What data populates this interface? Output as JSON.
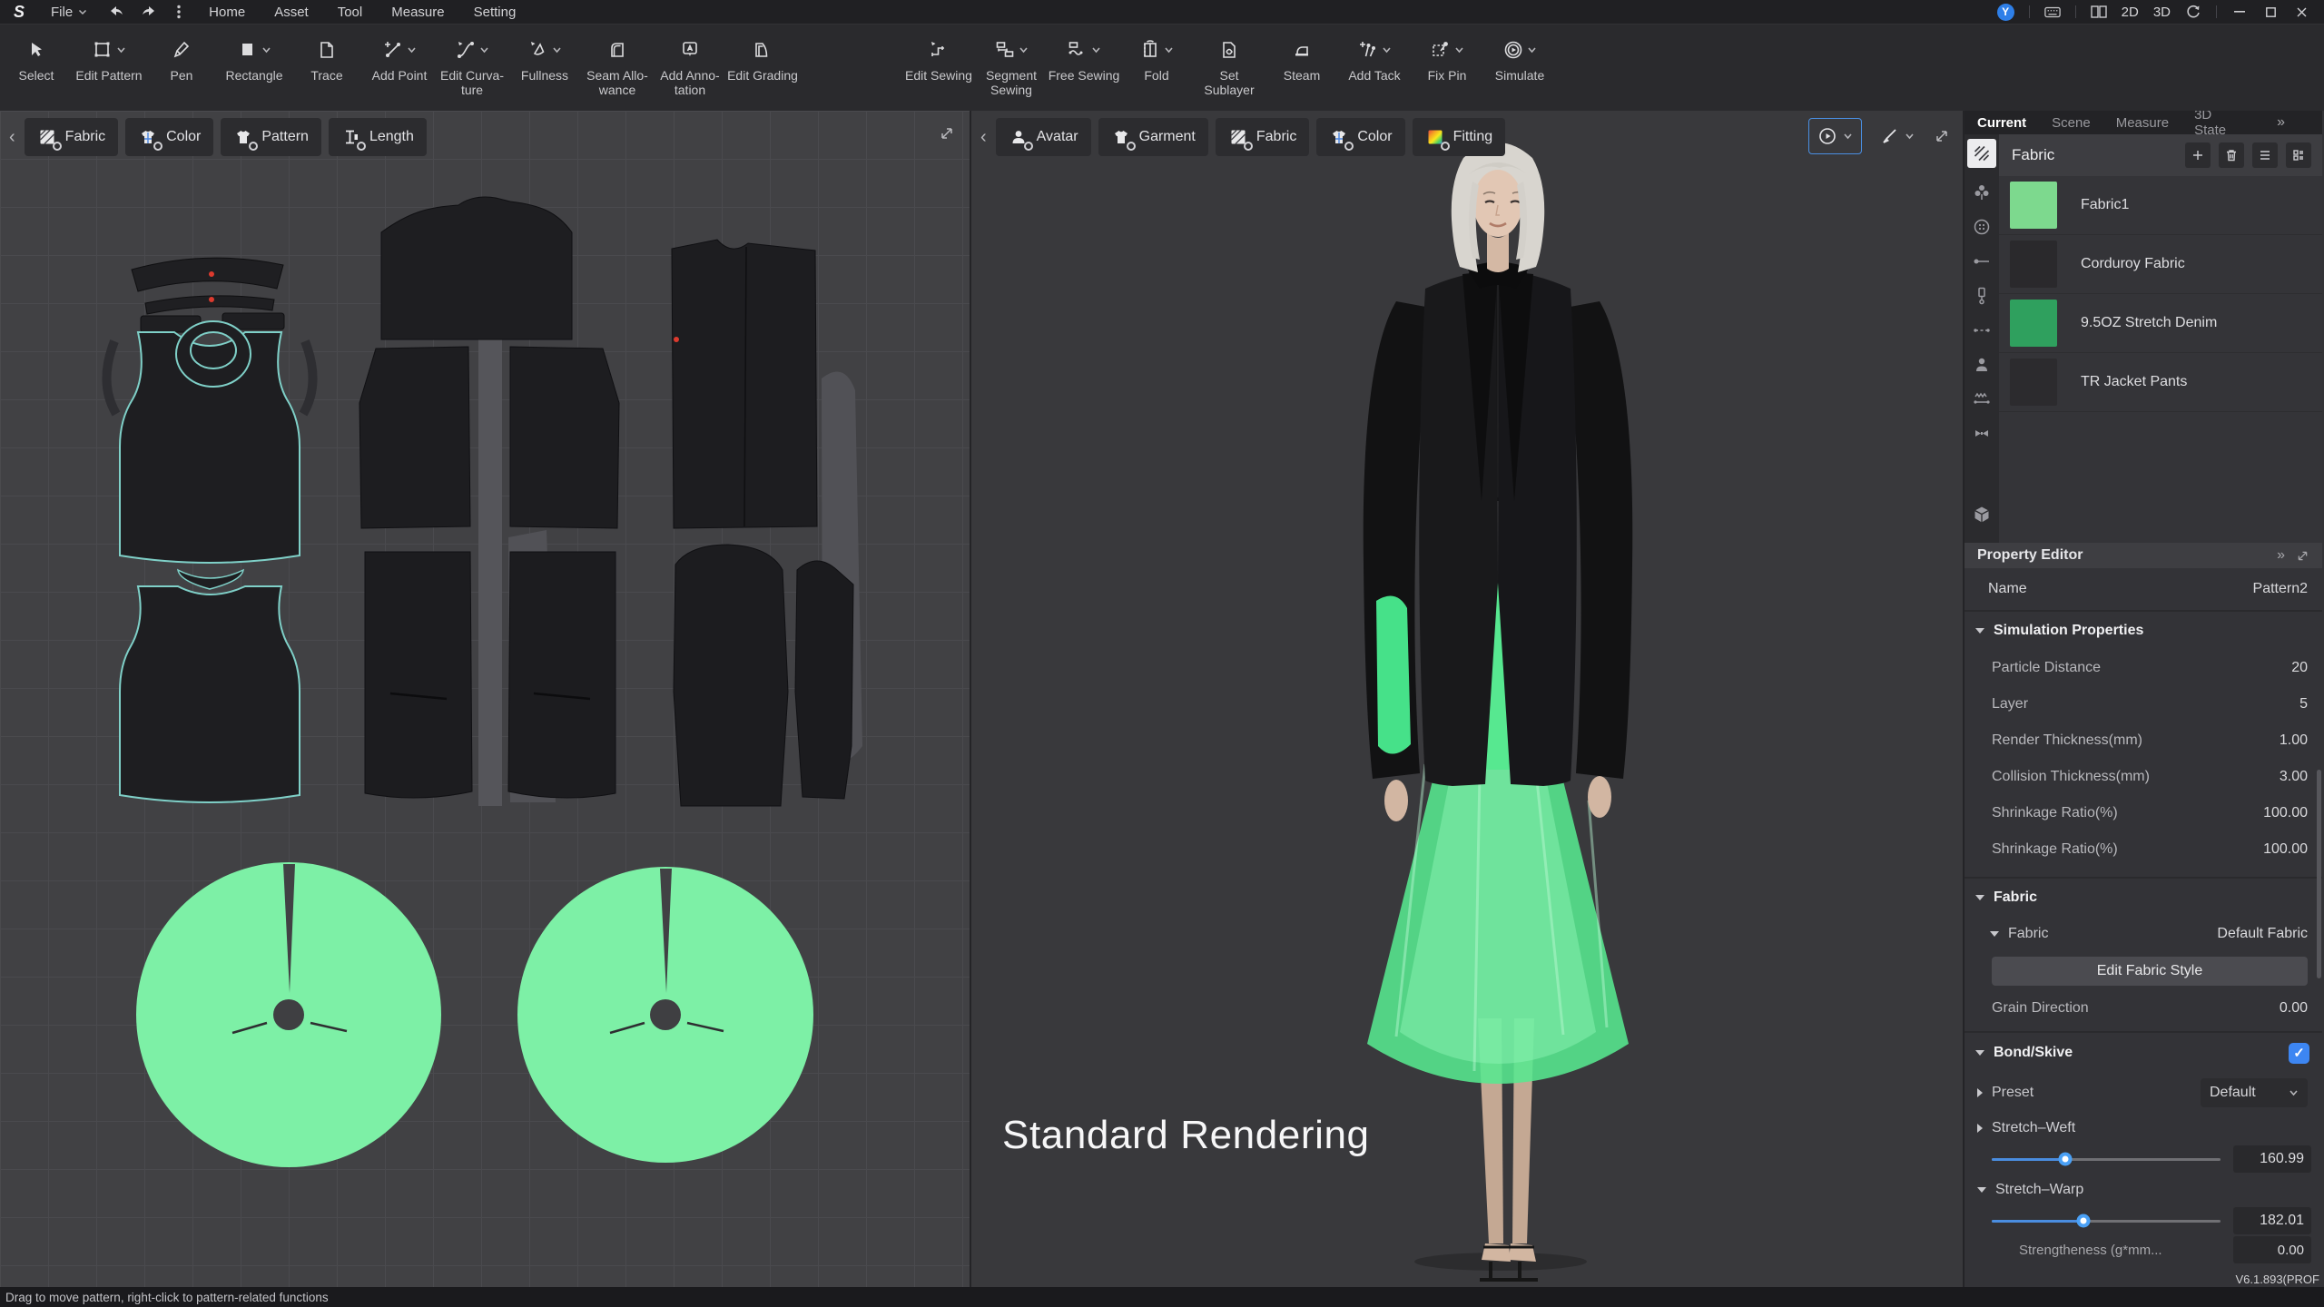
{
  "app": {
    "status_hint": "Drag to move pattern, right-click to pattern-related functions",
    "version": "V6.1.893(PROF",
    "overlay_label": "Standard Rendering"
  },
  "menubar": {
    "file": "File",
    "menus": [
      "Home",
      "Asset",
      "Tool",
      "Measure",
      "Setting"
    ],
    "user_initial": "Y",
    "mode_2d": "2D",
    "mode_3d": "3D"
  },
  "toolbar": {
    "left": [
      {
        "label": "Select"
      },
      {
        "label": "Edit Pattern"
      },
      {
        "label": "Pen"
      },
      {
        "label": "Rectangle"
      },
      {
        "label": "Trace"
      },
      {
        "label": "Add Point"
      },
      {
        "label": "Edit Curva-ture"
      },
      {
        "label": "Fullness"
      },
      {
        "label": "Seam Allo-wance"
      },
      {
        "label": "Add Anno-tation"
      },
      {
        "label": "Edit Grading"
      }
    ],
    "right": [
      {
        "label": "Edit Sewing"
      },
      {
        "label": "Segment Sewing"
      },
      {
        "label": "Free Sewing"
      },
      {
        "label": "Fold"
      },
      {
        "label": "Set Sublayer"
      },
      {
        "label": "Steam"
      },
      {
        "label": "Add Tack"
      },
      {
        "label": "Fix Pin"
      },
      {
        "label": "Simulate"
      }
    ]
  },
  "panel2d": {
    "tabs": [
      "Fabric",
      "Color",
      "Pattern",
      "Length"
    ]
  },
  "panel3d": {
    "tabs": [
      "Avatar",
      "Garment",
      "Fabric",
      "Color",
      "Fitting"
    ]
  },
  "right_panel": {
    "tabs": [
      "Current",
      "Scene",
      "Measure",
      "3D State"
    ],
    "library_title": "Fabric",
    "fabrics": [
      {
        "name": "Fabric1",
        "color": "#7dd98e"
      },
      {
        "name": "Corduroy Fabric",
        "color": "#2a292c"
      },
      {
        "name": "9.5OZ Stretch Denim",
        "color": "#2fa05e"
      },
      {
        "name": "TR Jacket Pants",
        "color": "#2c2b2e"
      }
    ],
    "property_editor": {
      "title": "Property Editor",
      "name_label": "Name",
      "name_value": "Pattern2",
      "sim_title": "Simulation Properties",
      "sim_rows": [
        {
          "label": "Particle Distance",
          "value": "20"
        },
        {
          "label": "Layer",
          "value": "5"
        },
        {
          "label": "Render Thickness(mm)",
          "value": "1.00"
        },
        {
          "label": "Collision Thickness(mm)",
          "value": "3.00"
        },
        {
          "label": "Shrinkage Ratio(%)",
          "value": "100.00"
        },
        {
          "label": "Shrinkage Ratio(%)",
          "value": "100.00"
        }
      ],
      "fabric_title": "Fabric",
      "fabric_label": "Fabric",
      "fabric_value": "Default Fabric",
      "edit_fabric_btn": "Edit Fabric Style",
      "grain_label": "Grain Direction",
      "grain_value": "0.00",
      "bond_title": "Bond/Skive",
      "preset_label": "Preset",
      "preset_value": "Default",
      "weft_label": "Stretch–Weft",
      "weft_value": "160.99",
      "weft_pct": "32%",
      "warp_label": "Stretch–Warp",
      "warp_value": "182.01",
      "warp_pct": "40%",
      "strength_label": "Strengtheness (g*mm...",
      "strength_value": "0.00"
    }
  },
  "colors": {
    "accent_blue": "#3d86f2",
    "circle_green": "#7df0a6",
    "skirt_green": "#57e890"
  }
}
